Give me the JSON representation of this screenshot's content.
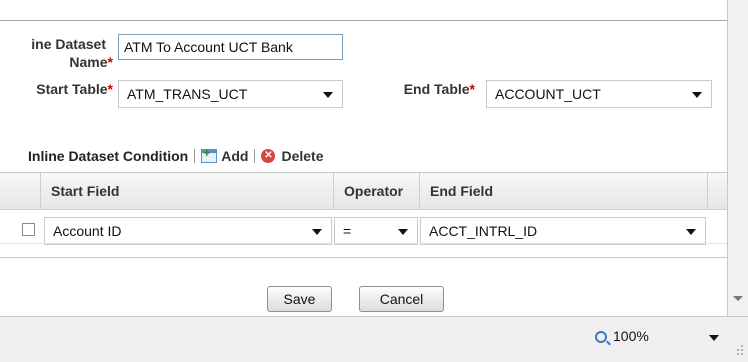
{
  "form": {
    "dataset_name_label_line1": "ine Dataset",
    "dataset_name_label_line2": "Name",
    "dataset_name_value": "ATM To Account UCT Bank",
    "start_table_label": "Start Table",
    "start_table_value": "ATM_TRANS_UCT",
    "end_table_label": "End Table",
    "end_table_value": "ACCOUNT_UCT",
    "required_marker": "*"
  },
  "condition": {
    "title": "Inline Dataset Condition",
    "add_label": "Add",
    "delete_label": "Delete"
  },
  "grid": {
    "columns": [
      "Start Field",
      "Operator",
      "End Field"
    ],
    "rows": [
      {
        "start_field": "Account ID",
        "operator": "=",
        "end_field": "ACCT_INTRL_ID"
      }
    ]
  },
  "buttons": {
    "save": "Save",
    "cancel": "Cancel"
  },
  "statusbar": {
    "zoom": "100%"
  }
}
